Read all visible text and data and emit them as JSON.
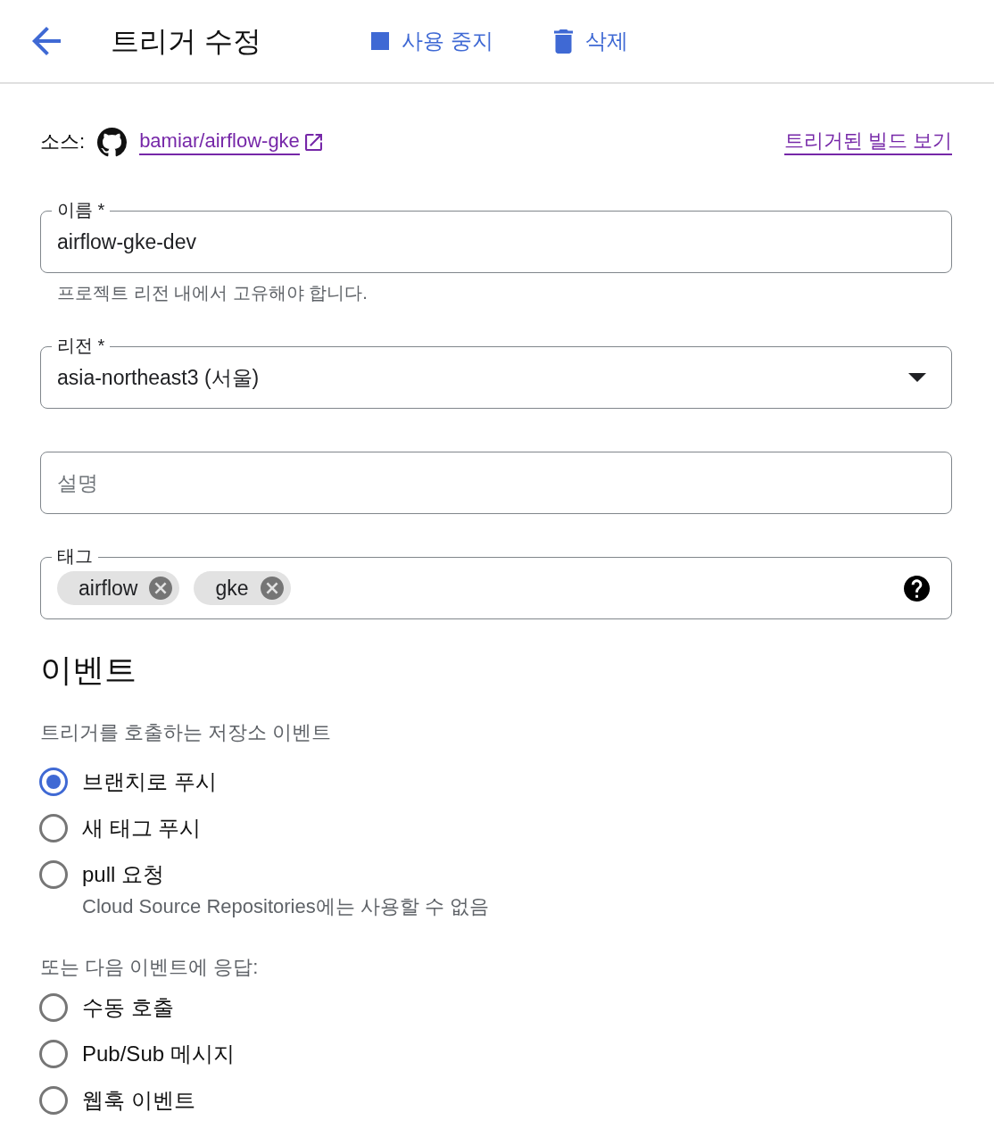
{
  "header": {
    "title": "트리거 수정",
    "actions": [
      {
        "kind": "stop",
        "label": "사용 중지"
      },
      {
        "kind": "delete",
        "label": "삭제"
      }
    ]
  },
  "source": {
    "label": "소스:",
    "repository": "bamiar/airflow-gke",
    "builds_link": "트리거된 빌드 보기"
  },
  "fields": [
    {
      "kind": "text",
      "label": "이름 *",
      "value": "airflow-gke-dev",
      "helper": "프로젝트 리전 내에서 고유해야 합니다."
    },
    {
      "kind": "select",
      "label": "리전 *",
      "value": "asia-northeast3 (서울)"
    },
    {
      "kind": "text",
      "placeholder": "설명"
    },
    {
      "kind": "tags",
      "label": "태그",
      "tags": [
        "airflow",
        "gke"
      ]
    }
  ],
  "events": {
    "title": "이벤트",
    "groups": [
      {
        "caption": "트리거를 호출하는 저장소 이벤트",
        "options": [
          {
            "label": "브랜치로 푸시",
            "selected": true
          },
          {
            "label": "새 태그 푸시",
            "selected": false
          },
          {
            "label": "pull 요청",
            "selected": false,
            "note": "Cloud Source Repositories에는 사용할 수 없음"
          }
        ]
      },
      {
        "caption": "또는 다음 이벤트에 응답:",
        "options": [
          {
            "label": "수동 호출",
            "selected": false
          },
          {
            "label": "Pub/Sub 메시지",
            "selected": false
          },
          {
            "label": "웹훅 이벤트",
            "selected": false
          }
        ]
      }
    ]
  }
}
